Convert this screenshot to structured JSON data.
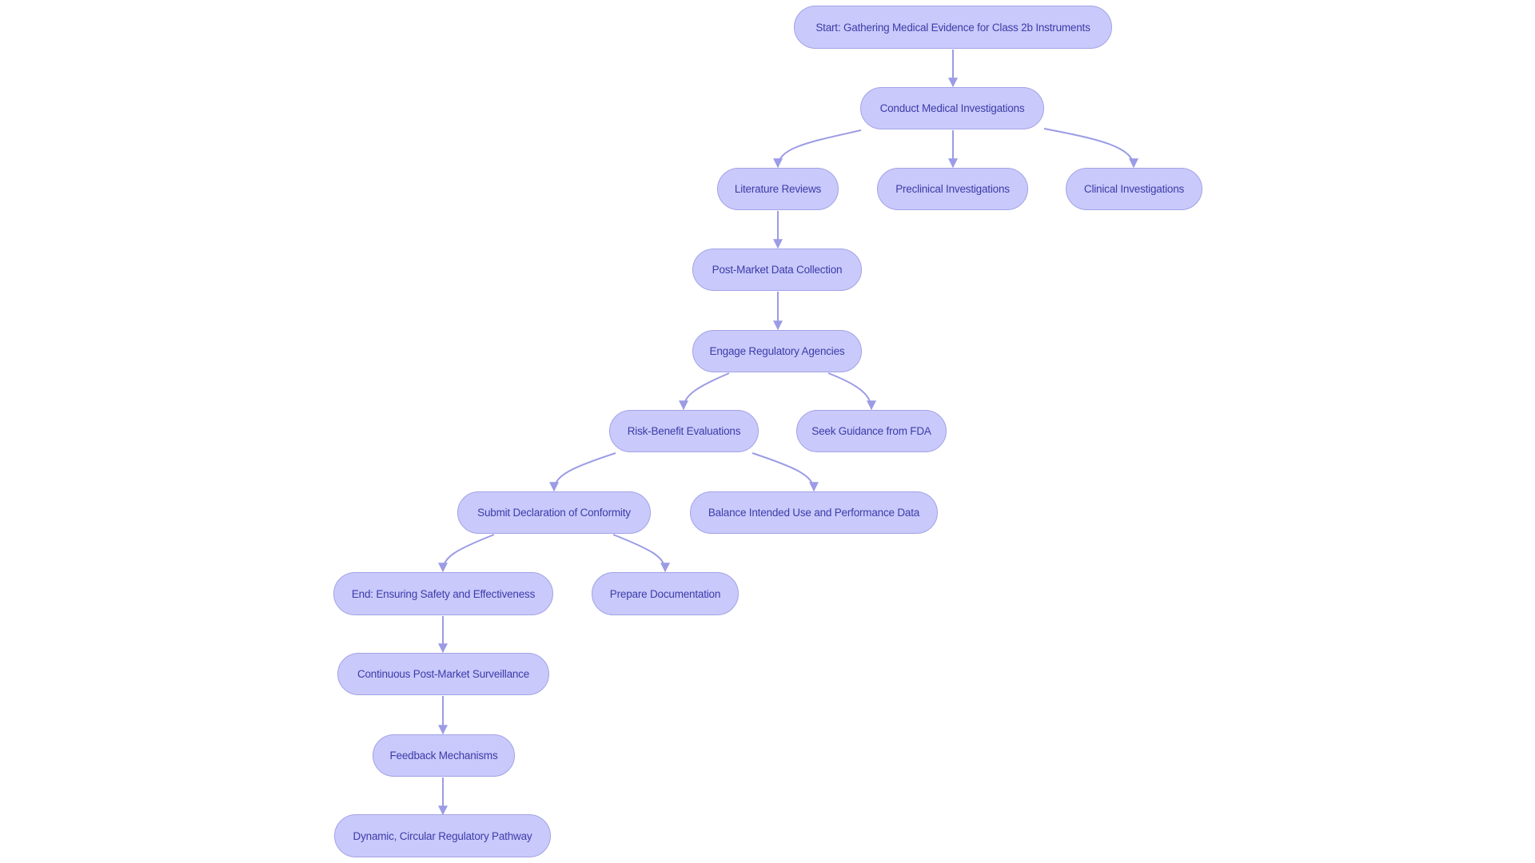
{
  "diagram": {
    "type": "flowchart",
    "colors": {
      "node_fill": "#c9c9fb",
      "node_border": "#a3a3e6",
      "text": "#3c3caa",
      "edge": "#9b9be6"
    },
    "nodes": [
      {
        "id": "start",
        "label": "Start: Gathering Medical Evidence for Class 2b Instruments"
      },
      {
        "id": "conduct",
        "label": "Conduct Medical Investigations"
      },
      {
        "id": "literature",
        "label": "Literature Reviews"
      },
      {
        "id": "preclinical",
        "label": "Preclinical Investigations"
      },
      {
        "id": "clinical",
        "label": "Clinical Investigations"
      },
      {
        "id": "postmarket",
        "label": "Post-Market Data Collection"
      },
      {
        "id": "engage",
        "label": "Engage Regulatory Agencies"
      },
      {
        "id": "risk",
        "label": "Risk-Benefit Evaluations"
      },
      {
        "id": "seek",
        "label": "Seek Guidance from FDA"
      },
      {
        "id": "submit",
        "label": "Submit Declaration of Conformity"
      },
      {
        "id": "balance",
        "label": "Balance Intended Use and Performance Data"
      },
      {
        "id": "end",
        "label": "End: Ensuring Safety and Effectiveness"
      },
      {
        "id": "prepare",
        "label": "Prepare Documentation"
      },
      {
        "id": "continuous",
        "label": "Continuous Post-Market Surveillance"
      },
      {
        "id": "feedback",
        "label": "Feedback Mechanisms"
      },
      {
        "id": "dynamic",
        "label": "Dynamic, Circular Regulatory Pathway"
      }
    ],
    "edges": [
      {
        "from": "start",
        "to": "conduct"
      },
      {
        "from": "conduct",
        "to": "literature"
      },
      {
        "from": "conduct",
        "to": "preclinical"
      },
      {
        "from": "conduct",
        "to": "clinical"
      },
      {
        "from": "literature",
        "to": "postmarket"
      },
      {
        "from": "postmarket",
        "to": "engage"
      },
      {
        "from": "engage",
        "to": "risk"
      },
      {
        "from": "engage",
        "to": "seek"
      },
      {
        "from": "risk",
        "to": "submit"
      },
      {
        "from": "risk",
        "to": "balance"
      },
      {
        "from": "submit",
        "to": "end"
      },
      {
        "from": "submit",
        "to": "prepare"
      },
      {
        "from": "end",
        "to": "continuous"
      },
      {
        "from": "continuous",
        "to": "feedback"
      },
      {
        "from": "feedback",
        "to": "dynamic"
      }
    ]
  }
}
